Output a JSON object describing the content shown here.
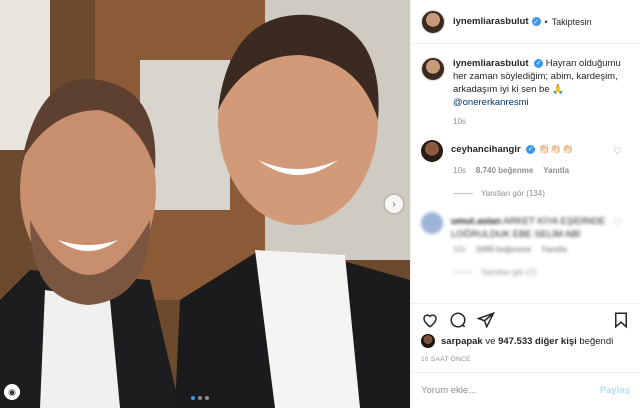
{
  "header": {
    "username": "iynemliarasbulut",
    "separator": "•",
    "follow_status": "Takiptesin"
  },
  "caption": {
    "username": "iynemliarasbulut",
    "text": "Hayran olduğumu her zaman söylediğim; abim, kardeşim, arkadaşım iyi ki sen be 🙏",
    "mention": "@onererkanresmi",
    "time": "10s"
  },
  "comments": [
    {
      "username": "ceyhancihangir",
      "text": "👏🏻👏🏻👏🏻",
      "time": "10s",
      "likes": "8.740 beğenme",
      "reply": "Yanıtla",
      "view_replies": "Yanıtları gör (134)"
    },
    {
      "username": "umut.aslan",
      "text": "ARKET KİYA EŞİDİNDE LOĞRULDUK EBE SELİM ABİ",
      "time": "10s",
      "likes": "1699 beğenme",
      "reply": "Yanıtla",
      "view_replies": "Yanıtları gör (7)"
    }
  ],
  "likes": {
    "user": "sarpapak",
    "connector": "ve",
    "count": "947.533 diğer kişi",
    "suffix": "beğendi"
  },
  "timestamp": "10 SAAT ÖNCE",
  "add_comment": {
    "placeholder": "Yorum ekle...",
    "post_label": "Paylaş"
  },
  "colors": {
    "verified": "#3897f0",
    "link": "#00376b",
    "muted": "#8e8e8e",
    "post_disabled": "#b2dffc"
  },
  "icons": [
    "verified-icon",
    "heart-icon",
    "comment-icon",
    "share-icon",
    "bookmark-icon",
    "chevron-right-icon",
    "praying-hands-emoji",
    "clapping-hands-emoji"
  ]
}
